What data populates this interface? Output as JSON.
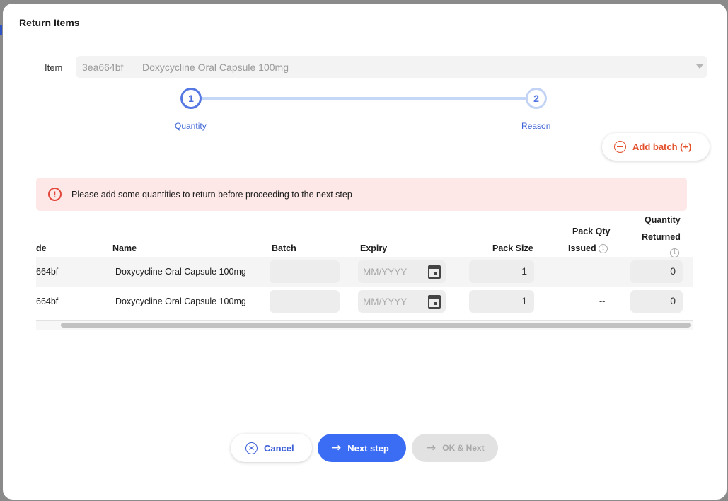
{
  "dialog": {
    "title": "Return Items"
  },
  "item": {
    "label": "Item",
    "code": "3ea664bf",
    "name": "Doxycycline Oral Capsule 100mg"
  },
  "stepper": {
    "steps": [
      {
        "number": "1",
        "label": "Quantity"
      },
      {
        "number": "2",
        "label": "Reason"
      }
    ]
  },
  "add_batch": {
    "label": "Add batch (+)"
  },
  "alert": {
    "message": "Please add some quantities to return before proceeding to the next step"
  },
  "table": {
    "headers": {
      "code": "de",
      "name": "Name",
      "batch": "Batch",
      "expiry": "Expiry",
      "pack_size": "Pack Size",
      "pack_qty_issued_line1": "Pack Qty",
      "pack_qty_issued_line2": "Issued",
      "quantity_returned_line1": "Quantity",
      "quantity_returned_line2": "Returned"
    },
    "rows": [
      {
        "code": "664bf",
        "name": "Doxycycline Oral Capsule 100mg",
        "batch": "",
        "expiry_placeholder": "MM/YYYY",
        "pack_size": "1",
        "pack_qty_issued": "--",
        "quantity_returned": "0"
      },
      {
        "code": "664bf",
        "name": "Doxycycline Oral Capsule 100mg",
        "batch": "",
        "expiry_placeholder": "MM/YYYY",
        "pack_size": "1",
        "pack_qty_issued": "--",
        "quantity_returned": "0"
      }
    ]
  },
  "footer": {
    "cancel_label": "Cancel",
    "next_label": "Next step",
    "ok_next_label": "OK & Next"
  },
  "colors": {
    "primary": "#3b6cf4",
    "accent_orange": "#e2502c",
    "alert_bg": "#fde8e7",
    "error": "#e2463a"
  },
  "icons": [
    "alert-circle-icon",
    "plus-circle-icon",
    "calendar-icon",
    "info-icon",
    "x-circle-icon",
    "arrow-right-icon",
    "chevron-down-icon"
  ]
}
